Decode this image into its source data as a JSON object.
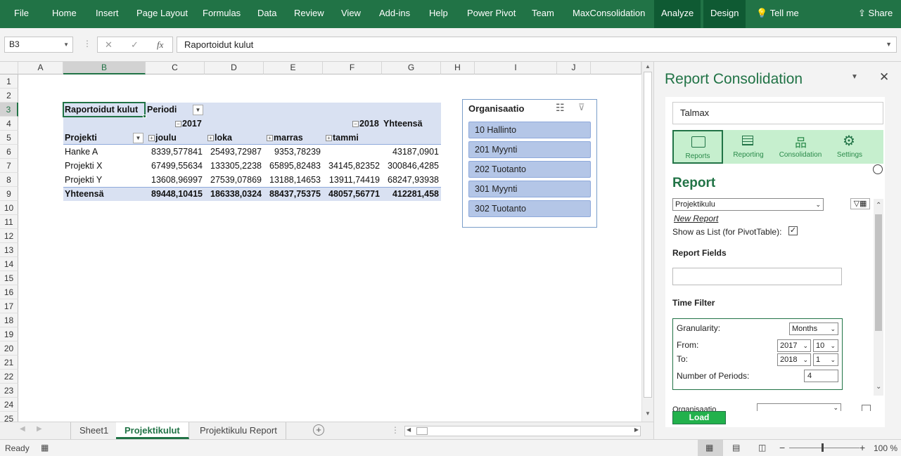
{
  "ribbon": {
    "tabs": [
      "File",
      "Home",
      "Insert",
      "Page Layout",
      "Formulas",
      "Data",
      "Review",
      "View",
      "Add-ins",
      "Help",
      "Power Pivot",
      "Team",
      "MaxConsolidation",
      "Analyze",
      "Design"
    ],
    "tell_me": "Tell me",
    "share": "Share"
  },
  "formula_bar": {
    "name_box": "B3",
    "cancel": "✕",
    "enter": "✓",
    "fx": "fx",
    "content": "Raportoidut kulut"
  },
  "columns": [
    "A",
    "B",
    "C",
    "D",
    "E",
    "F",
    "G",
    "H",
    "I",
    "J"
  ],
  "rows": [
    "1",
    "2",
    "3",
    "4",
    "5",
    "6",
    "7",
    "8",
    "9",
    "10",
    "11",
    "12",
    "13",
    "14",
    "15",
    "16",
    "17",
    "18",
    "19",
    "20",
    "21",
    "22",
    "23",
    "24",
    "25"
  ],
  "pivot": {
    "value_label": "Raportoidut kulut",
    "col_field": "Periodi",
    "year_2017": "2017",
    "year_2018": "2018",
    "total_header": "Yhteensä",
    "row_field": "Projekti",
    "months": [
      "joulu",
      "loka",
      "marras",
      "tammi"
    ],
    "rows": [
      {
        "name": "Hanke A",
        "values": [
          "8339,577841",
          "25493,72987",
          "9353,78239",
          "",
          "43187,0901"
        ]
      },
      {
        "name": "Projekti X",
        "values": [
          "67499,55634",
          "133305,2238",
          "65895,82483",
          "34145,82352",
          "300846,4285"
        ]
      },
      {
        "name": "Projekti Y",
        "values": [
          "13608,96997",
          "27539,07869",
          "13188,14653",
          "13911,74419",
          "68247,93938"
        ]
      }
    ],
    "total": {
      "name": "Yhteensä",
      "values": [
        "89448,10415",
        "186338,0324",
        "88437,75375",
        "48057,56771",
        "412281,458"
      ]
    }
  },
  "slicer": {
    "title": "Organisaatio",
    "items": [
      "10 Hallinto",
      "201 Myynti",
      "202 Tuotanto",
      "301 Myynti",
      "302 Tuotanto"
    ]
  },
  "sheets": {
    "tabs": [
      "Sheet1",
      "Projektikulut",
      "Projektikulu Report"
    ],
    "active": "Projektikulut"
  },
  "status": {
    "ready": "Ready",
    "zoom": "100 %"
  },
  "pane": {
    "title": "Report Consolidation",
    "company": "Talmax",
    "nav": [
      {
        "label": "Reports",
        "icon": "reports-icon"
      },
      {
        "label": "Reporting",
        "icon": "table-icon"
      },
      {
        "label": "Consolidation",
        "icon": "hierarchy-icon"
      },
      {
        "label": "Settings",
        "icon": "gear-icon"
      }
    ],
    "section_title": "Report",
    "report_select": "Projektikulu",
    "new_report": "New Report",
    "show_as_list": "Show as List (for PivotTable):",
    "show_as_list_checked": true,
    "report_fields": "Report Fields",
    "time_filter": "Time Filter",
    "granularity_label": "Granularity:",
    "granularity": "Months",
    "from_label": "From:",
    "from_year": "2017",
    "from_period": "10",
    "to_label": "To:",
    "to_year": "2018",
    "to_period": "1",
    "periods_label": "Number of Periods:",
    "periods": "4",
    "org_label": "Organisaatio",
    "load": "Load"
  },
  "colors": {
    "excel_green": "#217346",
    "pivot_band": "#d9e1f2",
    "slicer_item": "#b4c6e7",
    "pane_green": "#c6efce"
  }
}
